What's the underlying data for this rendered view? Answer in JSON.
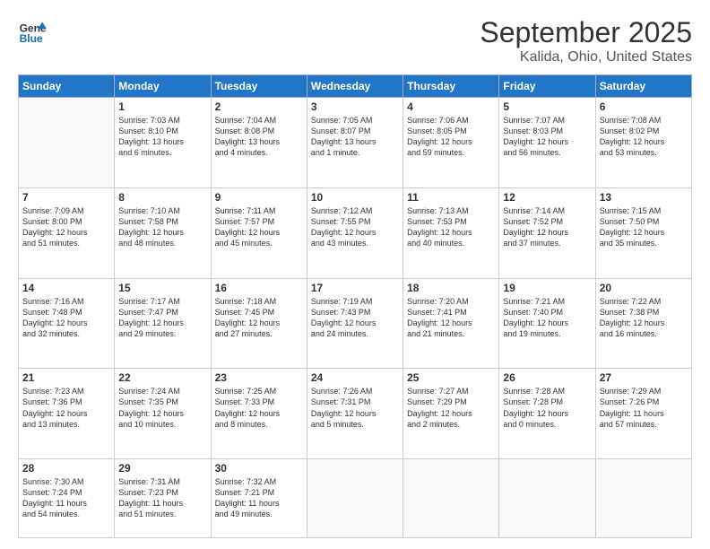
{
  "logo": {
    "line1": "General",
    "line2": "Blue"
  },
  "title": "September 2025",
  "location": "Kalida, Ohio, United States",
  "days_of_week": [
    "Sunday",
    "Monday",
    "Tuesday",
    "Wednesday",
    "Thursday",
    "Friday",
    "Saturday"
  ],
  "weeks": [
    [
      {
        "day": "",
        "info": ""
      },
      {
        "day": "1",
        "info": "Sunrise: 7:03 AM\nSunset: 8:10 PM\nDaylight: 13 hours\nand 6 minutes."
      },
      {
        "day": "2",
        "info": "Sunrise: 7:04 AM\nSunset: 8:08 PM\nDaylight: 13 hours\nand 4 minutes."
      },
      {
        "day": "3",
        "info": "Sunrise: 7:05 AM\nSunset: 8:07 PM\nDaylight: 13 hours\nand 1 minute."
      },
      {
        "day": "4",
        "info": "Sunrise: 7:06 AM\nSunset: 8:05 PM\nDaylight: 12 hours\nand 59 minutes."
      },
      {
        "day": "5",
        "info": "Sunrise: 7:07 AM\nSunset: 8:03 PM\nDaylight: 12 hours\nand 56 minutes."
      },
      {
        "day": "6",
        "info": "Sunrise: 7:08 AM\nSunset: 8:02 PM\nDaylight: 12 hours\nand 53 minutes."
      }
    ],
    [
      {
        "day": "7",
        "info": "Sunrise: 7:09 AM\nSunset: 8:00 PM\nDaylight: 12 hours\nand 51 minutes."
      },
      {
        "day": "8",
        "info": "Sunrise: 7:10 AM\nSunset: 7:58 PM\nDaylight: 12 hours\nand 48 minutes."
      },
      {
        "day": "9",
        "info": "Sunrise: 7:11 AM\nSunset: 7:57 PM\nDaylight: 12 hours\nand 45 minutes."
      },
      {
        "day": "10",
        "info": "Sunrise: 7:12 AM\nSunset: 7:55 PM\nDaylight: 12 hours\nand 43 minutes."
      },
      {
        "day": "11",
        "info": "Sunrise: 7:13 AM\nSunset: 7:53 PM\nDaylight: 12 hours\nand 40 minutes."
      },
      {
        "day": "12",
        "info": "Sunrise: 7:14 AM\nSunset: 7:52 PM\nDaylight: 12 hours\nand 37 minutes."
      },
      {
        "day": "13",
        "info": "Sunrise: 7:15 AM\nSunset: 7:50 PM\nDaylight: 12 hours\nand 35 minutes."
      }
    ],
    [
      {
        "day": "14",
        "info": "Sunrise: 7:16 AM\nSunset: 7:48 PM\nDaylight: 12 hours\nand 32 minutes."
      },
      {
        "day": "15",
        "info": "Sunrise: 7:17 AM\nSunset: 7:47 PM\nDaylight: 12 hours\nand 29 minutes."
      },
      {
        "day": "16",
        "info": "Sunrise: 7:18 AM\nSunset: 7:45 PM\nDaylight: 12 hours\nand 27 minutes."
      },
      {
        "day": "17",
        "info": "Sunrise: 7:19 AM\nSunset: 7:43 PM\nDaylight: 12 hours\nand 24 minutes."
      },
      {
        "day": "18",
        "info": "Sunrise: 7:20 AM\nSunset: 7:41 PM\nDaylight: 12 hours\nand 21 minutes."
      },
      {
        "day": "19",
        "info": "Sunrise: 7:21 AM\nSunset: 7:40 PM\nDaylight: 12 hours\nand 19 minutes."
      },
      {
        "day": "20",
        "info": "Sunrise: 7:22 AM\nSunset: 7:38 PM\nDaylight: 12 hours\nand 16 minutes."
      }
    ],
    [
      {
        "day": "21",
        "info": "Sunrise: 7:23 AM\nSunset: 7:36 PM\nDaylight: 12 hours\nand 13 minutes."
      },
      {
        "day": "22",
        "info": "Sunrise: 7:24 AM\nSunset: 7:35 PM\nDaylight: 12 hours\nand 10 minutes."
      },
      {
        "day": "23",
        "info": "Sunrise: 7:25 AM\nSunset: 7:33 PM\nDaylight: 12 hours\nand 8 minutes."
      },
      {
        "day": "24",
        "info": "Sunrise: 7:26 AM\nSunset: 7:31 PM\nDaylight: 12 hours\nand 5 minutes."
      },
      {
        "day": "25",
        "info": "Sunrise: 7:27 AM\nSunset: 7:29 PM\nDaylight: 12 hours\nand 2 minutes."
      },
      {
        "day": "26",
        "info": "Sunrise: 7:28 AM\nSunset: 7:28 PM\nDaylight: 12 hours\nand 0 minutes."
      },
      {
        "day": "27",
        "info": "Sunrise: 7:29 AM\nSunset: 7:26 PM\nDaylight: 11 hours\nand 57 minutes."
      }
    ],
    [
      {
        "day": "28",
        "info": "Sunrise: 7:30 AM\nSunset: 7:24 PM\nDaylight: 11 hours\nand 54 minutes."
      },
      {
        "day": "29",
        "info": "Sunrise: 7:31 AM\nSunset: 7:23 PM\nDaylight: 11 hours\nand 51 minutes."
      },
      {
        "day": "30",
        "info": "Sunrise: 7:32 AM\nSunset: 7:21 PM\nDaylight: 11 hours\nand 49 minutes."
      },
      {
        "day": "",
        "info": ""
      },
      {
        "day": "",
        "info": ""
      },
      {
        "day": "",
        "info": ""
      },
      {
        "day": "",
        "info": ""
      }
    ]
  ]
}
